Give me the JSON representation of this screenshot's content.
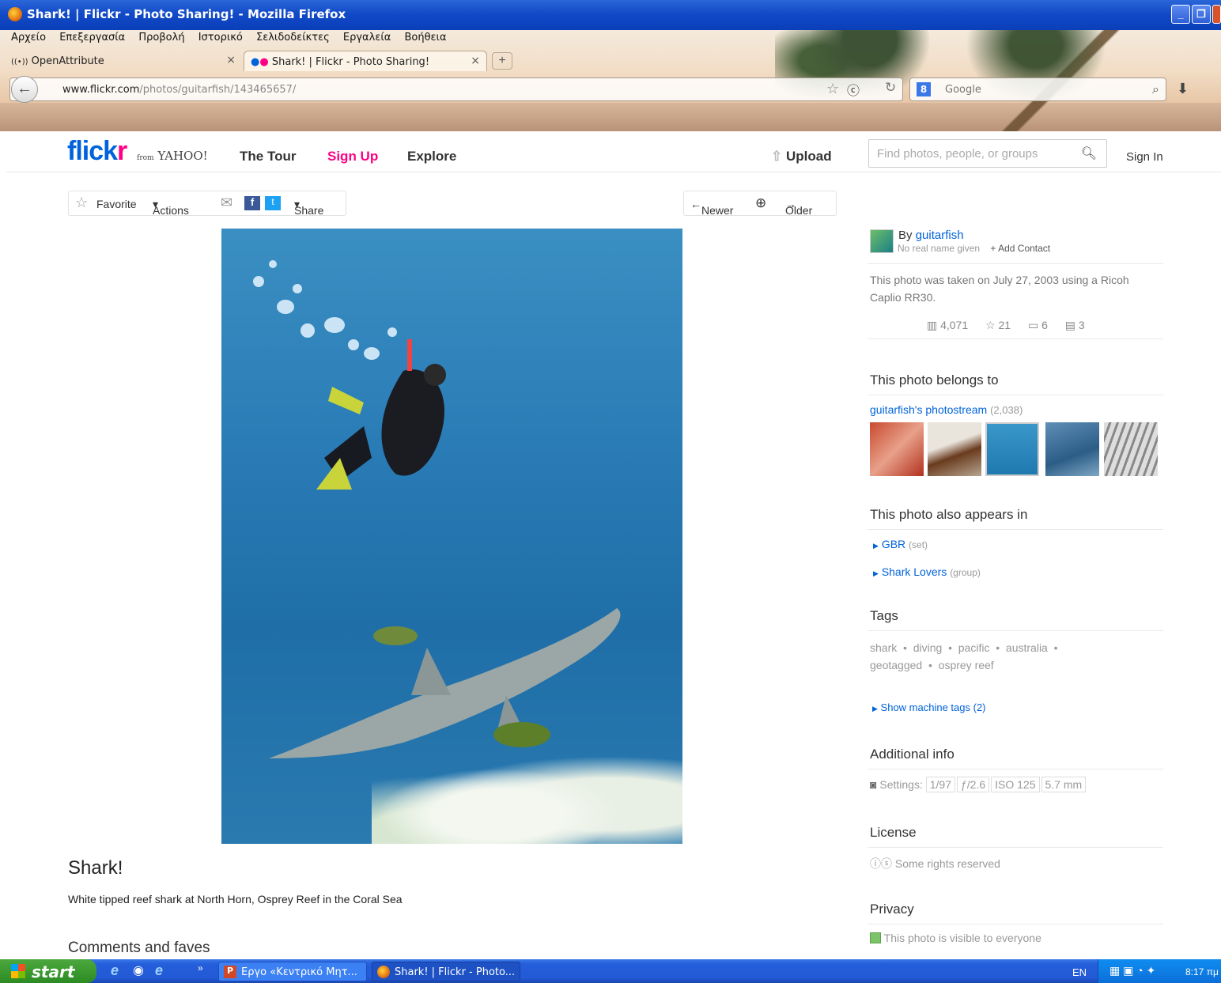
{
  "window": {
    "title": "Shark! | Flickr - Photo Sharing! - Mozilla Firefox",
    "menu": [
      "Αρχείο",
      "Επεξεργασία",
      "Προβολή",
      "Ιστορικό",
      "Σελιδοδείκτες",
      "Εργαλεία",
      "Βοήθεια"
    ],
    "tabs": [
      {
        "label": "OpenAttribute"
      },
      {
        "label": "Shark! | Flickr - Photo Sharing!"
      }
    ],
    "url_domain": "www.flickr.com",
    "url_path": "/photos/guitarfish/143465657/",
    "search_placeholder": "Google"
  },
  "header": {
    "logo_a": "flick",
    "logo_b": "r",
    "logo_from": "from",
    "logo_yahoo": "YAHOO!",
    "nav": [
      "The Tour",
      "Sign Up",
      "Explore"
    ],
    "upload": "Upload",
    "search_placeholder": "Find photos, people, or groups",
    "signin": "Sign In"
  },
  "toolbar": {
    "favorite": "Favorite",
    "actions": "Actions",
    "share": "Share",
    "newer": "Newer",
    "older": "Older"
  },
  "photo": {
    "title": "Shark!",
    "description": "White tipped reef shark at North Horn, Osprey Reef in the Coral Sea",
    "comments_heading": "Comments and faves"
  },
  "sidebar": {
    "by": "By",
    "owner": "guitarfish",
    "realname": "No real name given",
    "add_contact": "+ Add Contact",
    "taken": "This photo was taken on July 27, 2003 using a Ricoh Caplio RR30.",
    "stats": {
      "views": "4,071",
      "faves": "21",
      "comments": "6",
      "notes": "3"
    },
    "belongs_heading": "This photo belongs to",
    "photostream": "guitarfish's photostream",
    "photostream_count": "(2,038)",
    "appears_heading": "This photo also appears in",
    "appears": [
      {
        "name": "GBR",
        "kind": "(set)"
      },
      {
        "name": "Shark Lovers",
        "kind": "(group)"
      }
    ],
    "tags_heading": "Tags",
    "tags_line1": [
      "shark",
      "diving",
      "pacific",
      "australia"
    ],
    "tags_line2": [
      "geotagged",
      "osprey reef"
    ],
    "machine_tags": "Show machine tags (2)",
    "info_heading": "Additional info",
    "settings_label": "Settings:",
    "settings": [
      "1/97",
      "ƒ/2.6",
      "ISO 125",
      "5.7 mm"
    ],
    "license_heading": "License",
    "license": "Some rights reserved",
    "privacy_heading": "Privacy",
    "privacy": "This photo is visible to everyone"
  },
  "taskbar": {
    "start": "start",
    "tasks": [
      "Εργο «Κεντρικό Μητ...",
      "Shark! | Flickr - Photo..."
    ],
    "lang": "EN",
    "clock": "8:17 πμ"
  }
}
